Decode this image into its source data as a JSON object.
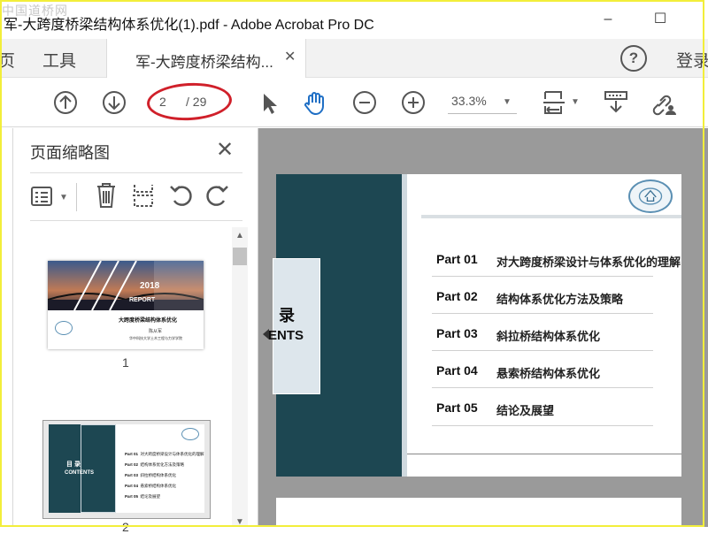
{
  "watermark": "中国道桥网",
  "window": {
    "title": "军-大跨度桥梁结构体系优化(1).pdf - Adobe Acrobat Pro DC",
    "minimize": "–",
    "maximize": "☐"
  },
  "menu": {
    "home_partial": "页",
    "tools": "工具",
    "tab_label": "军-大跨度桥梁结构...",
    "tab_close": "✕",
    "help": "?",
    "login": "登录"
  },
  "toolbar": {
    "current_page": "2",
    "total_pages": "/ 29",
    "zoom": "33.3%"
  },
  "thumbnails": {
    "title": "页面缩略图",
    "close": "✕",
    "items": [
      {
        "number": "1",
        "year": "2018",
        "report": "REPORT",
        "title": "大跨度桥梁结构体系优化",
        "author": "陈从军",
        "org": "华中科技大学土木工程与力学学院"
      },
      {
        "number": "2",
        "toc_cn": "目 录",
        "toc_en": "CONTENTS",
        "parts": [
          "Part 01",
          "Part 02",
          "Part 03",
          "Part 04",
          "Part 05"
        ],
        "texts": [
          "对大跨度桥梁设计与体系优化的理解",
          "结构体系优化方法及策略",
          "斜拉桥结构体系优化",
          "悬索桥结构体系优化",
          "结论及展望"
        ]
      }
    ]
  },
  "document": {
    "toc_cn": "录",
    "toc_en": "ENTS",
    "rows": [
      {
        "part": "Part 01",
        "text": "对大跨度桥梁设计与体系优化的理解"
      },
      {
        "part": "Part 02",
        "text": "结构体系优化方法及策略"
      },
      {
        "part": "Part 03",
        "text": "斜拉桥结构体系优化"
      },
      {
        "part": "Part 04",
        "text": "悬索桥结构体系优化"
      },
      {
        "part": "Part 05",
        "text": "结论及展望"
      }
    ]
  },
  "colors": {
    "accent_teal": "#1d4752",
    "annotation_red": "#d0202a",
    "frame_yellow": "#f2ee3a"
  }
}
